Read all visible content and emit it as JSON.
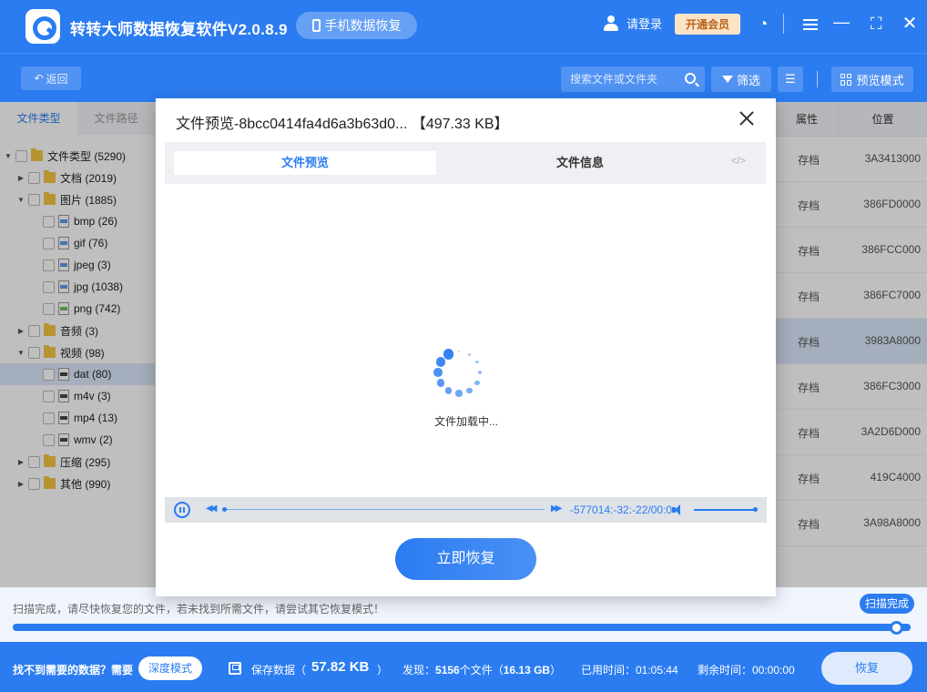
{
  "app": {
    "title": "转转大师数据恢复软件V2.0.8.9",
    "phone_recovery": "手机数据恢复",
    "login": "请登录",
    "vip": "开通会员"
  },
  "toolbar": {
    "back": "返回",
    "search_placeholder": "搜索文件或文件夹",
    "filter": "筛选",
    "preview_mode": "预览模式"
  },
  "sidebar": {
    "tabs": [
      "文件类型",
      "文件路径"
    ],
    "tree": [
      {
        "label": "文件类型 (5290)",
        "level": 0,
        "arrow": "▼",
        "icon": "folder"
      },
      {
        "label": "文档 (2019)",
        "level": 1,
        "arrow": "▶",
        "icon": "folder"
      },
      {
        "label": "图片 (1885)",
        "level": 1,
        "arrow": "▼",
        "icon": "folder"
      },
      {
        "label": "bmp (26)",
        "level": 2,
        "arrow": "",
        "icon": "img"
      },
      {
        "label": "gif (76)",
        "level": 2,
        "arrow": "",
        "icon": "img"
      },
      {
        "label": "jpeg (3)",
        "level": 2,
        "arrow": "",
        "icon": "img"
      },
      {
        "label": "jpg (1038)",
        "level": 2,
        "arrow": "",
        "icon": "img"
      },
      {
        "label": "png (742)",
        "level": 2,
        "arrow": "",
        "icon": "png"
      },
      {
        "label": "音频 (3)",
        "level": 1,
        "arrow": "▶",
        "icon": "folder"
      },
      {
        "label": "视频 (98)",
        "level": 1,
        "arrow": "▼",
        "icon": "folder"
      },
      {
        "label": "dat (80)",
        "level": 2,
        "arrow": "",
        "icon": "vid",
        "selected": true
      },
      {
        "label": "m4v (3)",
        "level": 2,
        "arrow": "",
        "icon": "vid"
      },
      {
        "label": "mp4 (13)",
        "level": 2,
        "arrow": "",
        "icon": "vid"
      },
      {
        "label": "wmv (2)",
        "level": 2,
        "arrow": "",
        "icon": "vid"
      },
      {
        "label": "压缩 (295)",
        "level": 1,
        "arrow": "▶",
        "icon": "folder"
      },
      {
        "label": "其他 (990)",
        "level": 1,
        "arrow": "▶",
        "icon": "folder"
      }
    ]
  },
  "table": {
    "headers": [
      "属性",
      "位置"
    ],
    "rows": [
      {
        "attr": "存档",
        "pos": "3A3413000"
      },
      {
        "attr": "存档",
        "pos": "386FD0000"
      },
      {
        "attr": "存档",
        "pos": "386FCC000"
      },
      {
        "attr": "存档",
        "pos": "386FC7000"
      },
      {
        "attr": "存档",
        "pos": "3983A8000",
        "selected": true
      },
      {
        "attr": "存档",
        "pos": "386FC3000"
      },
      {
        "attr": "存档",
        "pos": "3A2D6D000"
      },
      {
        "attr": "存档",
        "pos": "419C4000"
      },
      {
        "attr": "存档",
        "pos": "3A98A8000"
      }
    ]
  },
  "modal": {
    "title": "文件预览-8bcc0414fa4d6a3b63d0...  【497.33 KB】",
    "tab_preview": "文件预览",
    "tab_info": "文件信息",
    "code_icon": "</>",
    "loading": "文件加载中...",
    "timecode": "-577014:-32:-22/00:00:00",
    "recover_now": "立即恢复"
  },
  "status": {
    "message": "扫描完成，请尽快恢复您的文件，若未找到所需文件，请尝试其它恢复模式！",
    "done_badge": "扫描完成",
    "progress": 1.0
  },
  "bottom": {
    "not_found": "找不到需要的数据？需要",
    "deep_mode": "深度模式",
    "save_label": "保存数据（",
    "save_size": "57.82 KB",
    "save_close": "）",
    "found_prefix": "发现：",
    "found_count": "5156",
    "found_mid": "个文件（",
    "found_size": "16.13 GB",
    "found_suffix": "）",
    "used_time": "已用时间：01:05:44",
    "remain_time": "剩余时间：00:00:00",
    "recover": "恢复"
  },
  "colors": {
    "primary": "#2b7cf1",
    "vip_bg": "#fde3c6",
    "selected_row": "#dde9fb"
  }
}
